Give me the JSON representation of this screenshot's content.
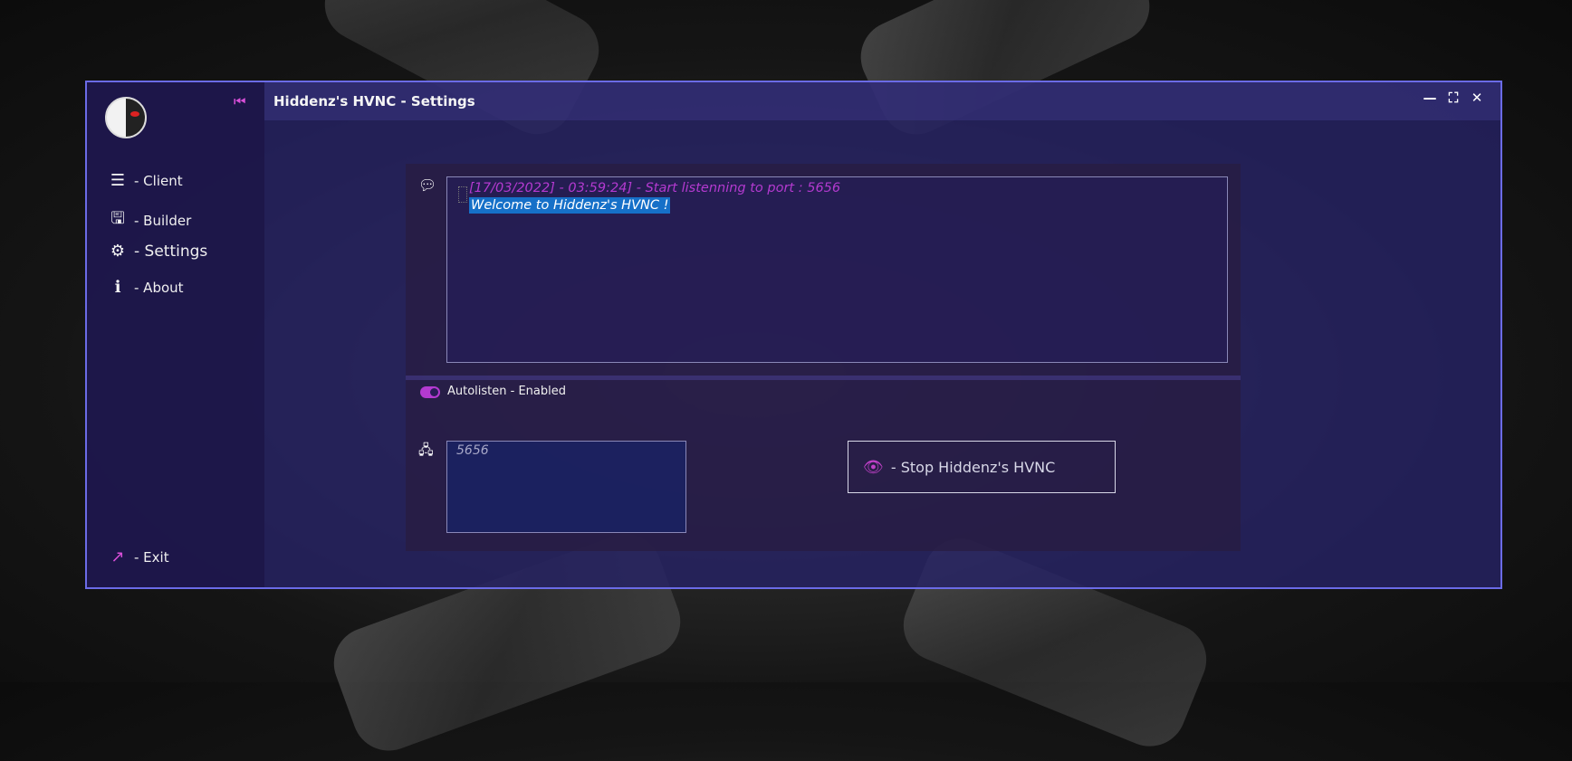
{
  "window": {
    "title": "Hiddenz's HVNC - Settings",
    "controls": {
      "minimize": "—",
      "maximize": "⛶",
      "close": "✕"
    }
  },
  "sidebar": {
    "collapse_icon": "⏮",
    "items": [
      {
        "label": "- Client",
        "icon": "list-icon",
        "glyph": "☰"
      },
      {
        "label": "- Builder",
        "icon": "save-icon",
        "glyph": "💾"
      },
      {
        "label": "- Settings",
        "icon": "gears-icon",
        "glyph": "⚙"
      },
      {
        "label": "- About",
        "icon": "info-icon",
        "glyph": "ℹ"
      }
    ],
    "exit": {
      "label": "- Exit",
      "icon": "exit-icon",
      "glyph": "↗"
    }
  },
  "log": {
    "lines": [
      "[17/03/2022] - 03:59:24] - Start listenning to port : 5656",
      "Welcome to Hiddenz's HVNC !"
    ]
  },
  "autolisten": {
    "label": "Autolisten - Enabled",
    "enabled": true
  },
  "port": {
    "value": "5656"
  },
  "stop_button": {
    "label": "- Stop Hiddenz's HVNC",
    "icon": "eye-icon"
  },
  "colors": {
    "accent": "#b43ad0",
    "border": "#6b6be6",
    "selection": "#1670c8"
  }
}
